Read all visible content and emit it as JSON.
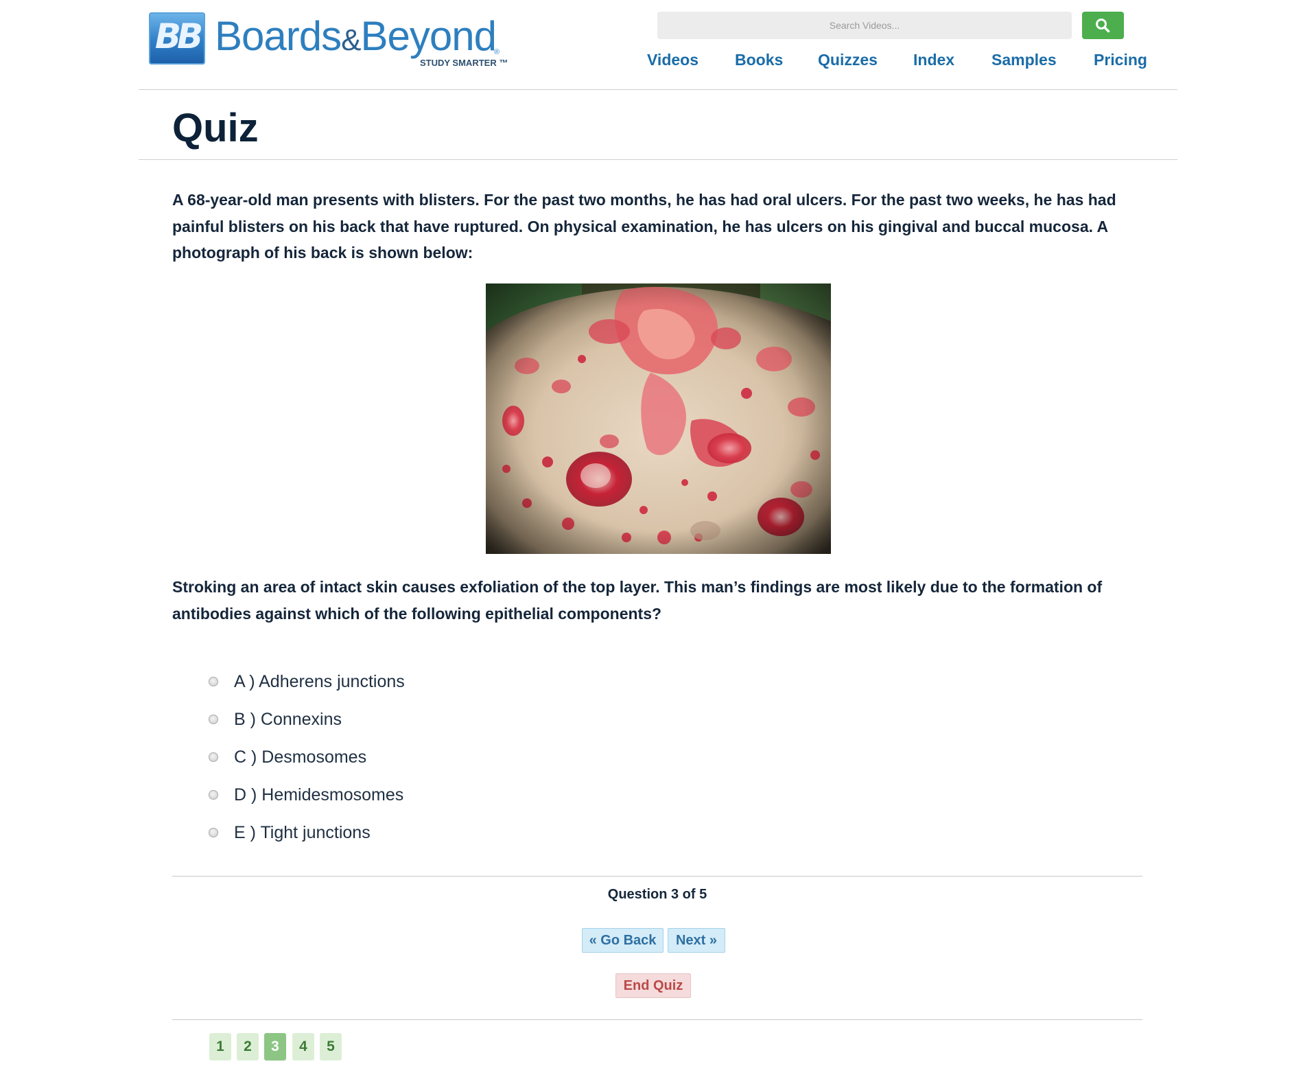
{
  "brand": {
    "mark": "BB",
    "name_part1": "Boards",
    "name_amp": "&",
    "name_part2": "Beyond",
    "registered": "®",
    "tagline": "STUDY SMARTER ™"
  },
  "search": {
    "placeholder": "Search Videos...",
    "button_color": "#4cae4c"
  },
  "nav": {
    "items": [
      {
        "label": "Videos"
      },
      {
        "label": "Books"
      },
      {
        "label": "Quizzes"
      },
      {
        "label": "Index"
      },
      {
        "label": "Samples"
      },
      {
        "label": "Pricing"
      }
    ]
  },
  "page": {
    "title": "Quiz"
  },
  "question": {
    "stem": "A 68-year-old man presents with blisters. For the past two months, he has had oral ulcers. For the past two weeks, he has had painful blisters on his back that have ruptured. On physical examination, he has ulcers on his gingival and buccal mucosa. A photograph of his back is shown below:",
    "prompt": "Stroking an area of intact skin causes exfoliation of the top layer. This man’s findings are most likely due to the formation of antibodies against which of the following epithelial components?",
    "options": [
      {
        "label": "A ) Adherens junctions"
      },
      {
        "label": "B ) Connexins"
      },
      {
        "label": "C ) Desmosomes"
      },
      {
        "label": "D ) Hemidesmosomes"
      },
      {
        "label": "E ) Tight junctions"
      }
    ]
  },
  "progress": {
    "counter_text": "Question 3 of 5",
    "current": 3,
    "total": 5
  },
  "controls": {
    "back_label": "« Go Back",
    "next_label": "Next »",
    "end_label": "End Quiz"
  },
  "pagination": {
    "pages": [
      "1",
      "2",
      "3",
      "4",
      "5"
    ],
    "current_index": 2
  },
  "colors": {
    "link_blue": "#1a6ca8",
    "title_navy": "#0d2238",
    "nav_button_bg": "#d3ecf8",
    "end_button_bg": "#f5dbdb",
    "end_button_text": "#b94a48",
    "pager_bg": "#dcefd6",
    "pager_current_bg": "#8dc584"
  }
}
